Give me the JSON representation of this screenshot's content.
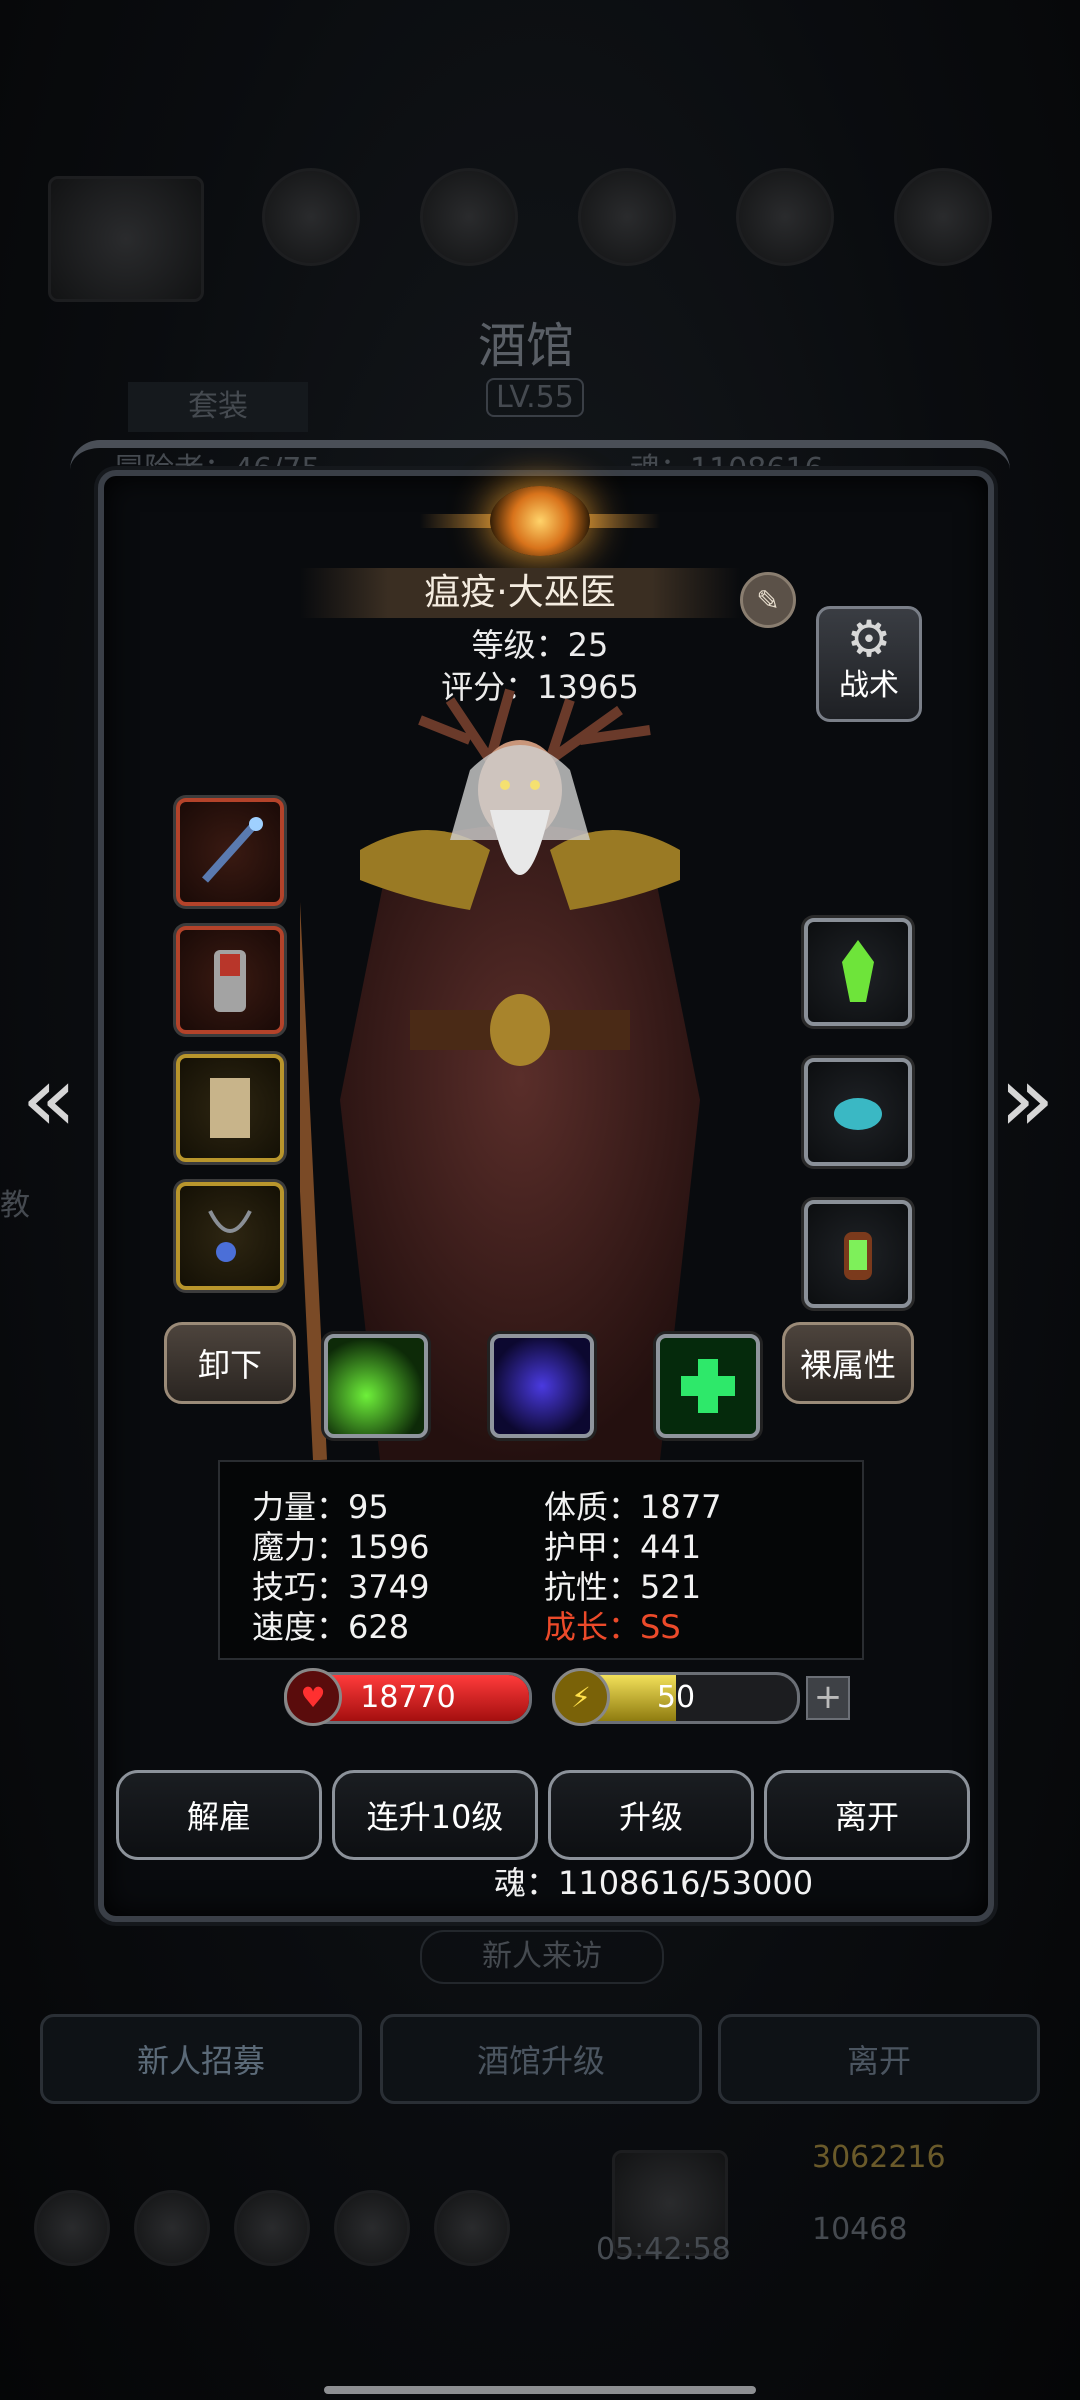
{
  "background": {
    "title": "酒馆",
    "level": "LV.55",
    "tab_label": "套装",
    "hero_count_label": "冒险者：46/75",
    "soul_label": "魂：1108616",
    "visit_label": "新人来访",
    "buttons": [
      "新人招募",
      "酒馆升级",
      "离开"
    ],
    "timer": "05:42:58",
    "gold": "3062216",
    "gems": "10468",
    "side_char": "教"
  },
  "hero": {
    "name": "瘟疫·大巫医",
    "level_line": "等级：25",
    "score_line": "评分：13965",
    "tactic_label": "战术"
  },
  "side_buttons": {
    "unequip": "卸下",
    "base_attr": "裸属性"
  },
  "stats": {
    "strength": "力量：95",
    "magic": "魔力：1596",
    "skill": "技巧：3749",
    "speed": "速度：628",
    "constitution": "体质：1877",
    "armor": "护甲：441",
    "resistance": "抗性：521",
    "growth": "成长：SS"
  },
  "bars": {
    "hp": "18770",
    "energy": "50",
    "hp_fill": 1.0,
    "energy_fill": 0.5
  },
  "actions": {
    "dismiss": "解雇",
    "upgrade10": "连升10级",
    "upgrade": "升级",
    "leave": "离开"
  },
  "soul_cost": "魂：1108616/53000",
  "colors": {
    "hp": "#d21a1a",
    "energy": "#d6c22a",
    "growth": "#ec4a2a"
  }
}
